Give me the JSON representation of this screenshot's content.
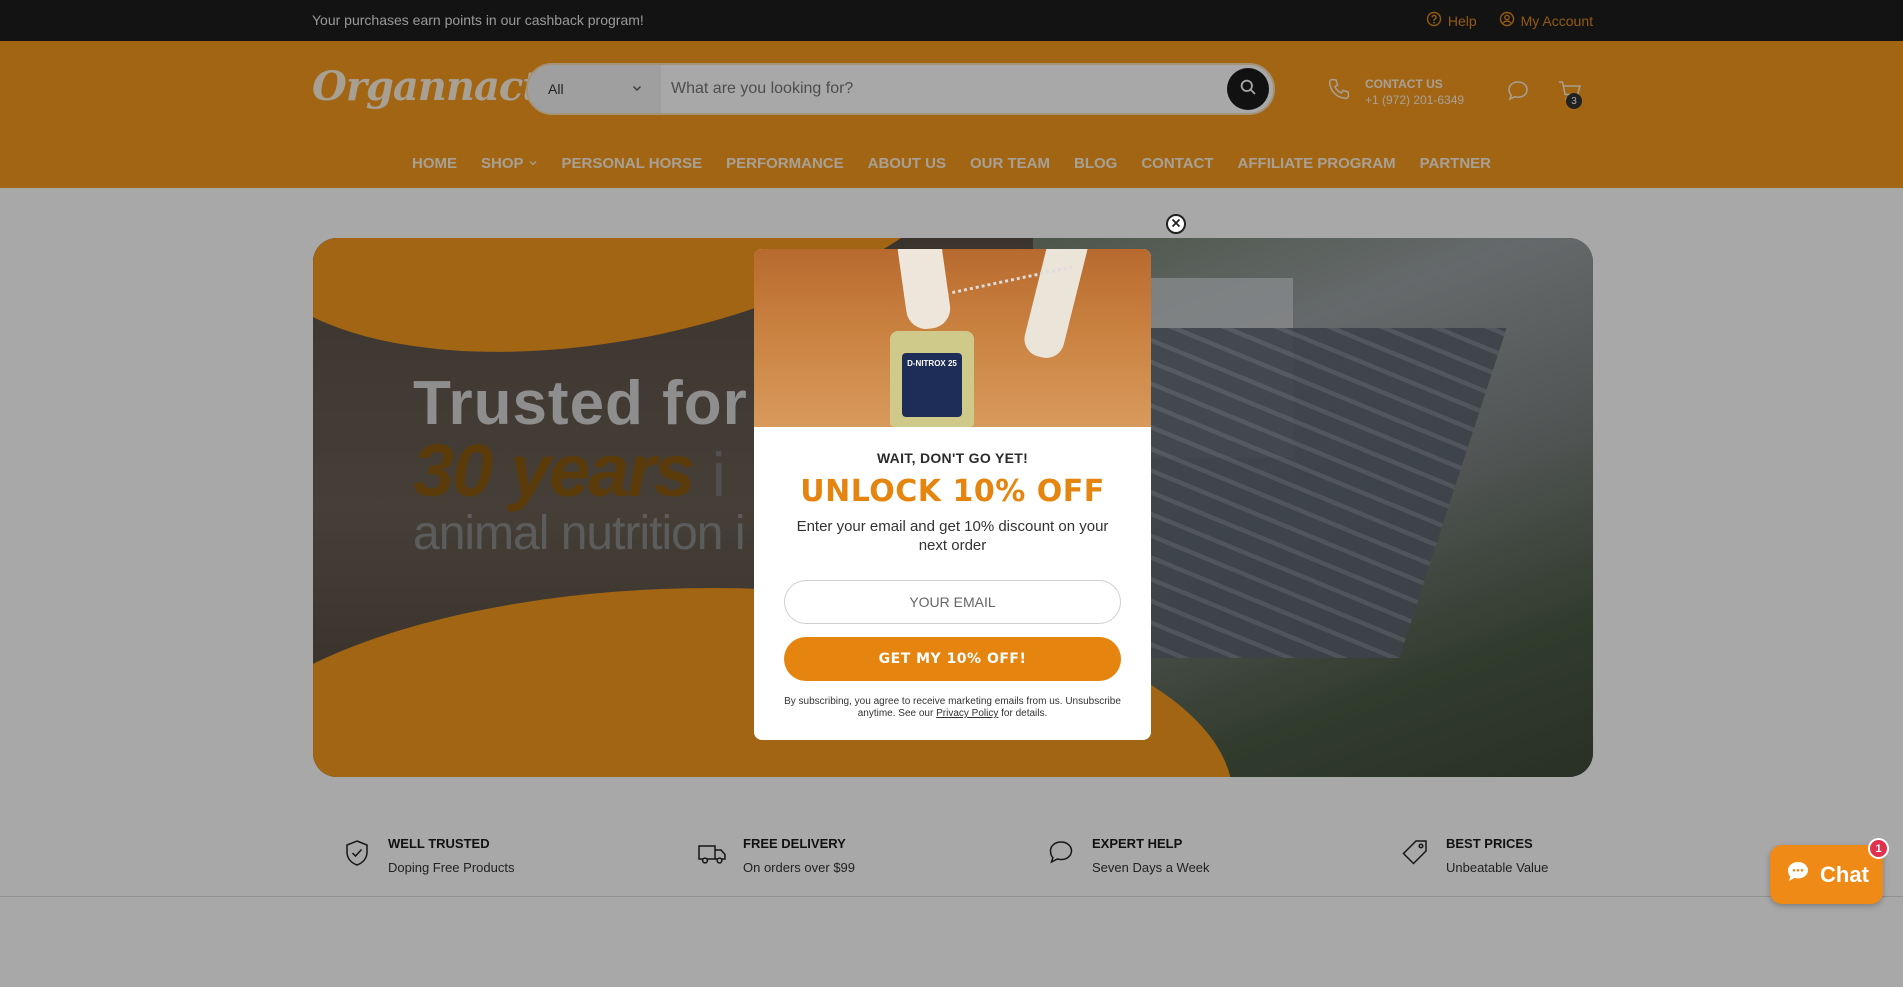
{
  "topbar": {
    "promo": "Your purchases earn points in our cashback program!",
    "help": "Help",
    "account": "My Account"
  },
  "header": {
    "logo": "Organnact",
    "search": {
      "category": "All",
      "placeholder": "What are you looking for?"
    },
    "contact": {
      "label": "CONTACT US",
      "phone": "+1 (972) 201-6349"
    },
    "cart_count": "3",
    "nav": [
      "HOME",
      "SHOP",
      "PERSONAL HORSE",
      "PERFORMANCE",
      "ABOUT US",
      "OUR TEAM",
      "BLOG",
      "CONTACT",
      "AFFILIATE PROGRAM",
      "PARTNER"
    ]
  },
  "hero": {
    "line1": "Trusted for",
    "line2": "30 years",
    "line2_suffix": "i",
    "line3": "animal nutrition i"
  },
  "features": [
    {
      "title": "WELL TRUSTED",
      "subtitle": "Doping Free Products",
      "icon": "shield-check-icon"
    },
    {
      "title": "FREE DELIVERY",
      "subtitle": "On orders over $99",
      "icon": "truck-icon"
    },
    {
      "title": "EXPERT HELP",
      "subtitle": "Seven Days a Week",
      "icon": "chat-bubble-icon"
    },
    {
      "title": "BEST PRICES",
      "subtitle": "Unbeatable Value",
      "icon": "price-tag-icon"
    }
  ],
  "popup": {
    "product_label": "D-NITROX 25",
    "eyebrow": "WAIT, DON'T GO YET!",
    "headline": "UNLOCK 10% OFF",
    "subtext": "Enter your email and get 10% discount on your next order",
    "email_placeholder": "YOUR EMAIL",
    "cta": "GET MY 10% OFF!",
    "legal_prefix": "By subscribing, you agree to receive marketing emails from us. Unsubscribe anytime. See our",
    "legal_link": "Privacy Policy",
    "legal_suffix": "for details."
  },
  "chat": {
    "label": "Chat",
    "badge": "1"
  },
  "colors": {
    "brand_orange": "#f59a1f",
    "cta_orange": "#e68410",
    "topbar_bg": "#1e1e1e",
    "chat_badge": "#e0314d"
  }
}
